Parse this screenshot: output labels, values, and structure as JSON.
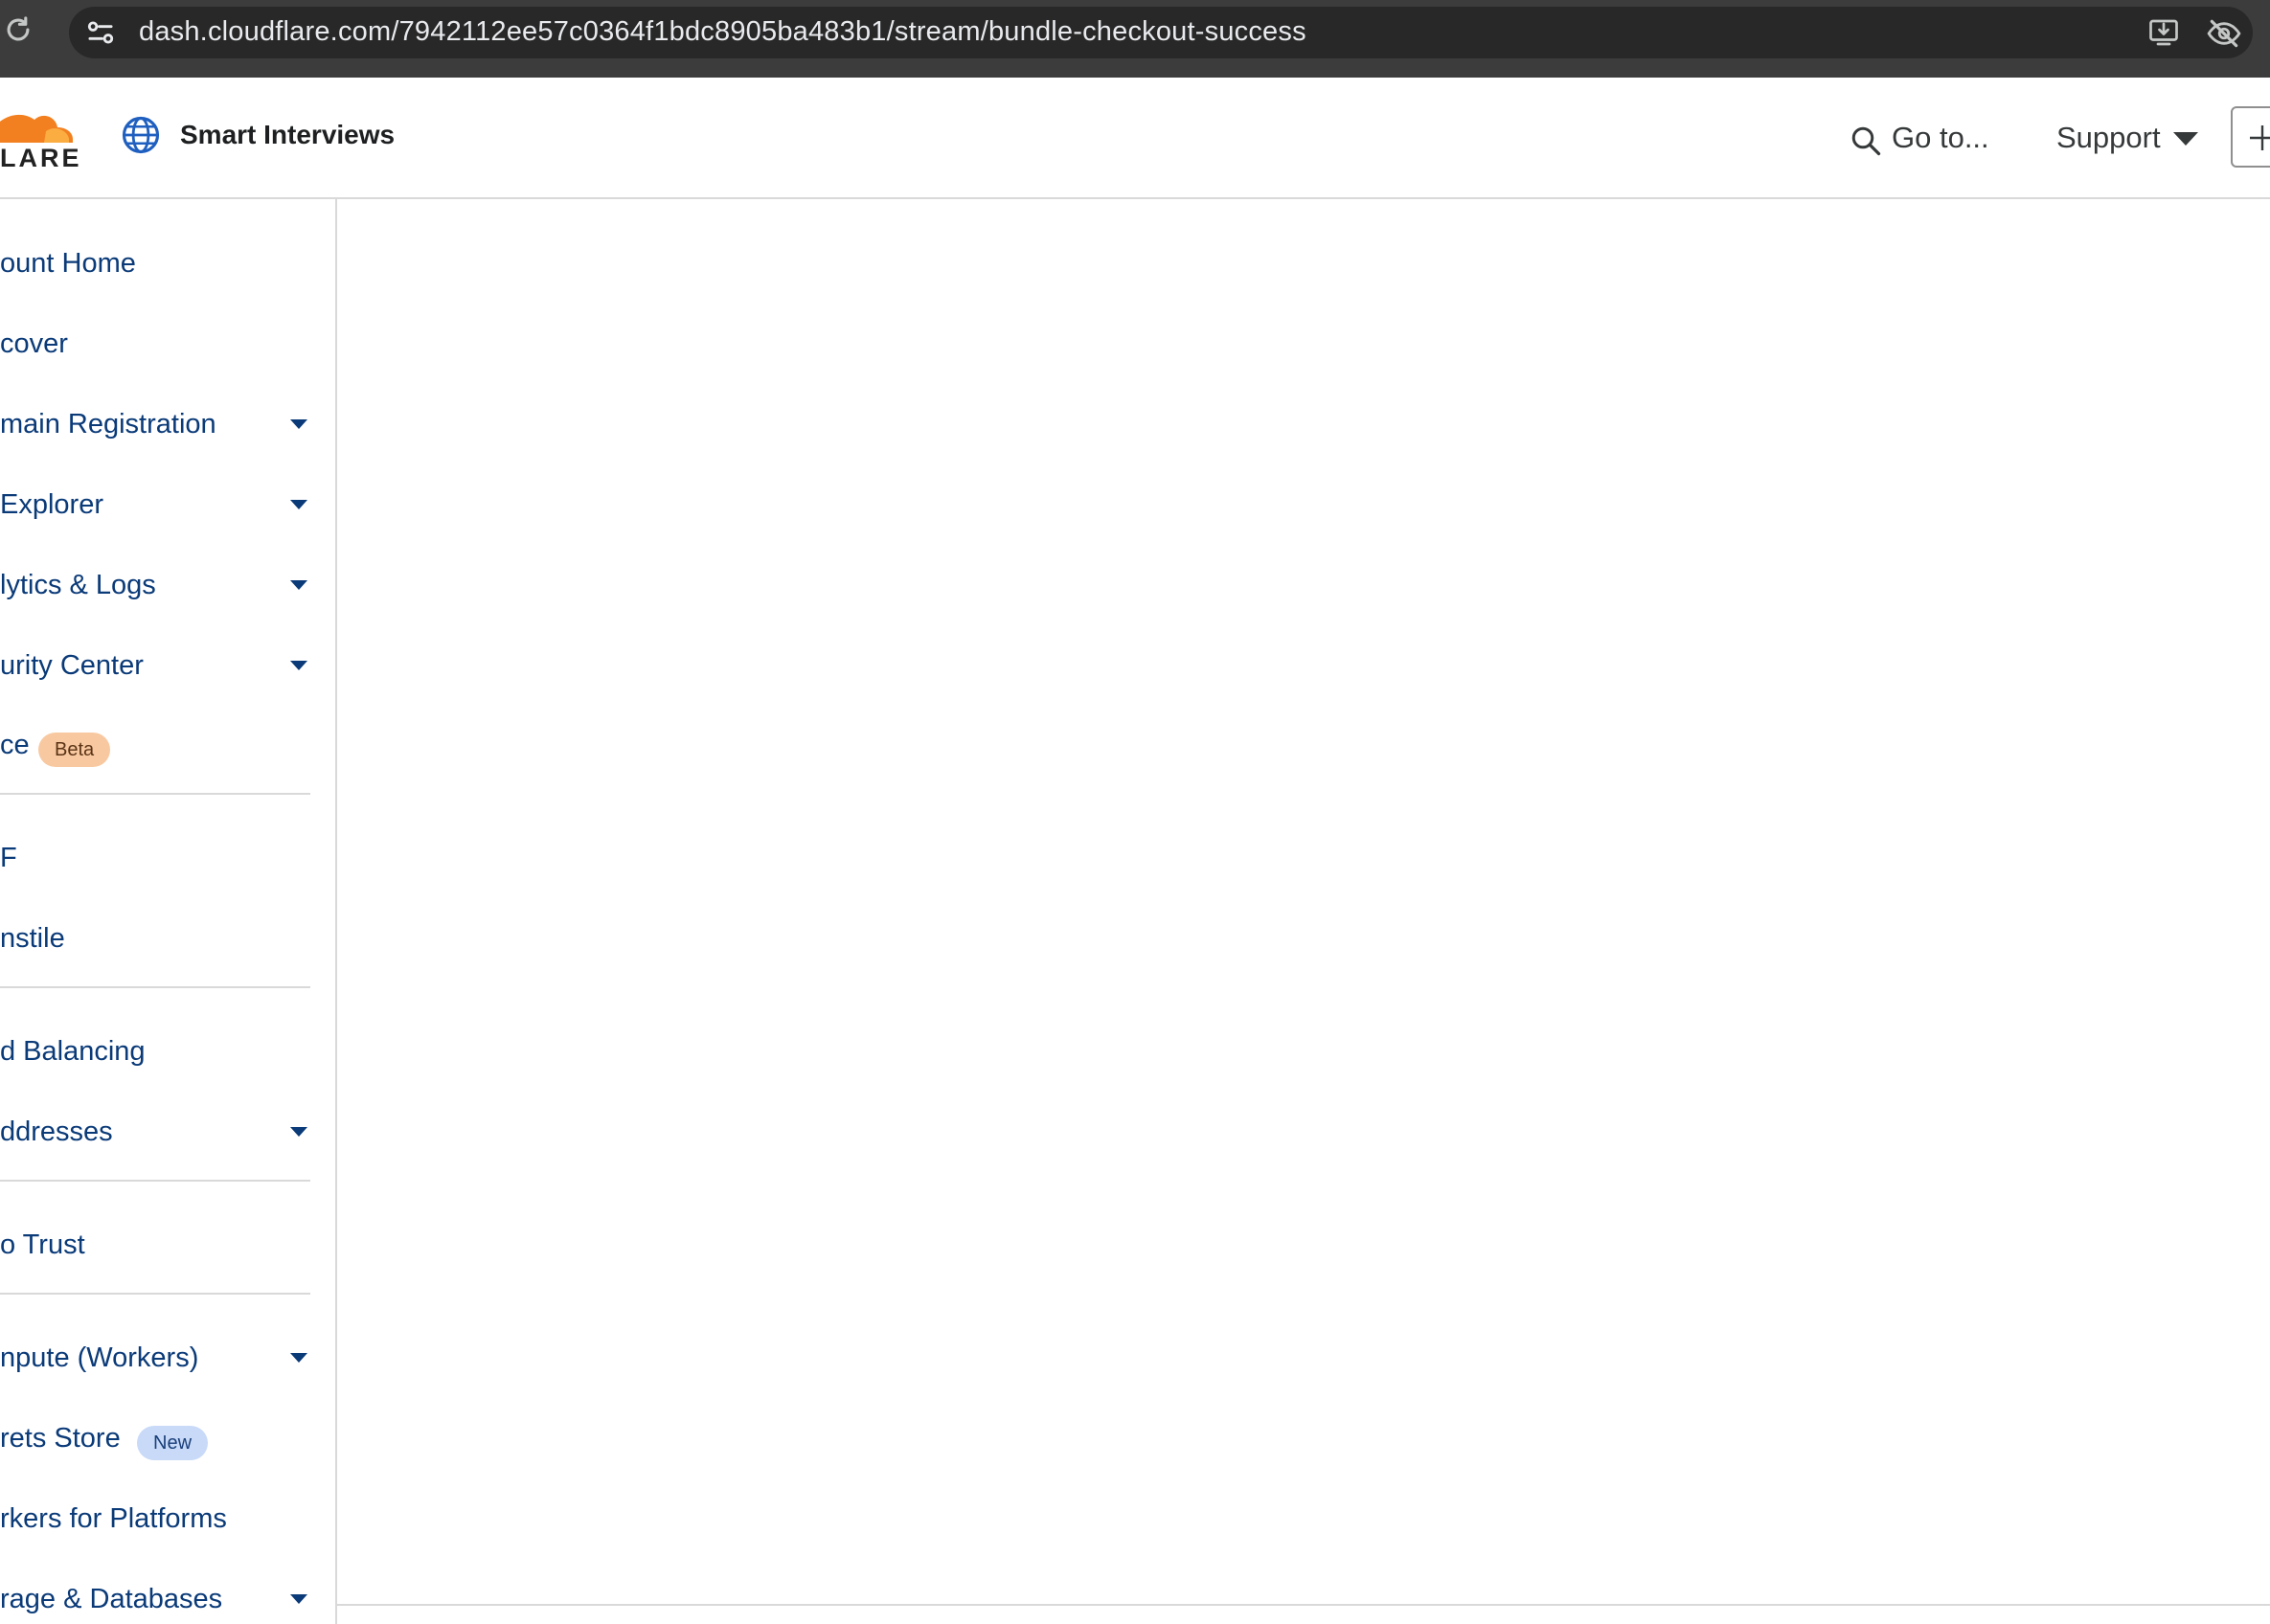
{
  "browser": {
    "url": "dash.cloudflare.com/7942112ee57c0364f1bdc8905ba483b1/stream/bundle-checkout-success",
    "icons": [
      "reload-icon",
      "site-info-icon",
      "install-icon",
      "eye-off-icon"
    ]
  },
  "header": {
    "logo_text": "LARE",
    "account_name": "Smart Interviews",
    "goto_label": "Go to...",
    "support_label": "Support",
    "brand_orange": "#f38020"
  },
  "sidebar": {
    "items": [
      {
        "label": "ount Home",
        "has_dropdown": false
      },
      {
        "label": "cover",
        "has_dropdown": false
      },
      {
        "label": "main Registration",
        "has_dropdown": true
      },
      {
        "label": " Explorer",
        "has_dropdown": true
      },
      {
        "label": "lytics & Logs",
        "has_dropdown": true
      },
      {
        "label": "urity Center",
        "has_dropdown": true
      },
      {
        "label": "ce",
        "has_dropdown": false,
        "badge": "Beta"
      },
      {
        "label": "F",
        "has_dropdown": false
      },
      {
        "label": "nstile",
        "has_dropdown": false
      },
      {
        "label": "d Balancing",
        "has_dropdown": false
      },
      {
        "label": "ddresses",
        "has_dropdown": true
      },
      {
        "label": "o Trust",
        "has_dropdown": false
      },
      {
        "label": "npute (Workers)",
        "has_dropdown": true
      },
      {
        "label": "rets Store",
        "has_dropdown": false,
        "badge": "New"
      },
      {
        "label": "rkers for Platforms",
        "has_dropdown": false
      },
      {
        "label": "rage & Databases",
        "has_dropdown": true
      }
    ]
  }
}
